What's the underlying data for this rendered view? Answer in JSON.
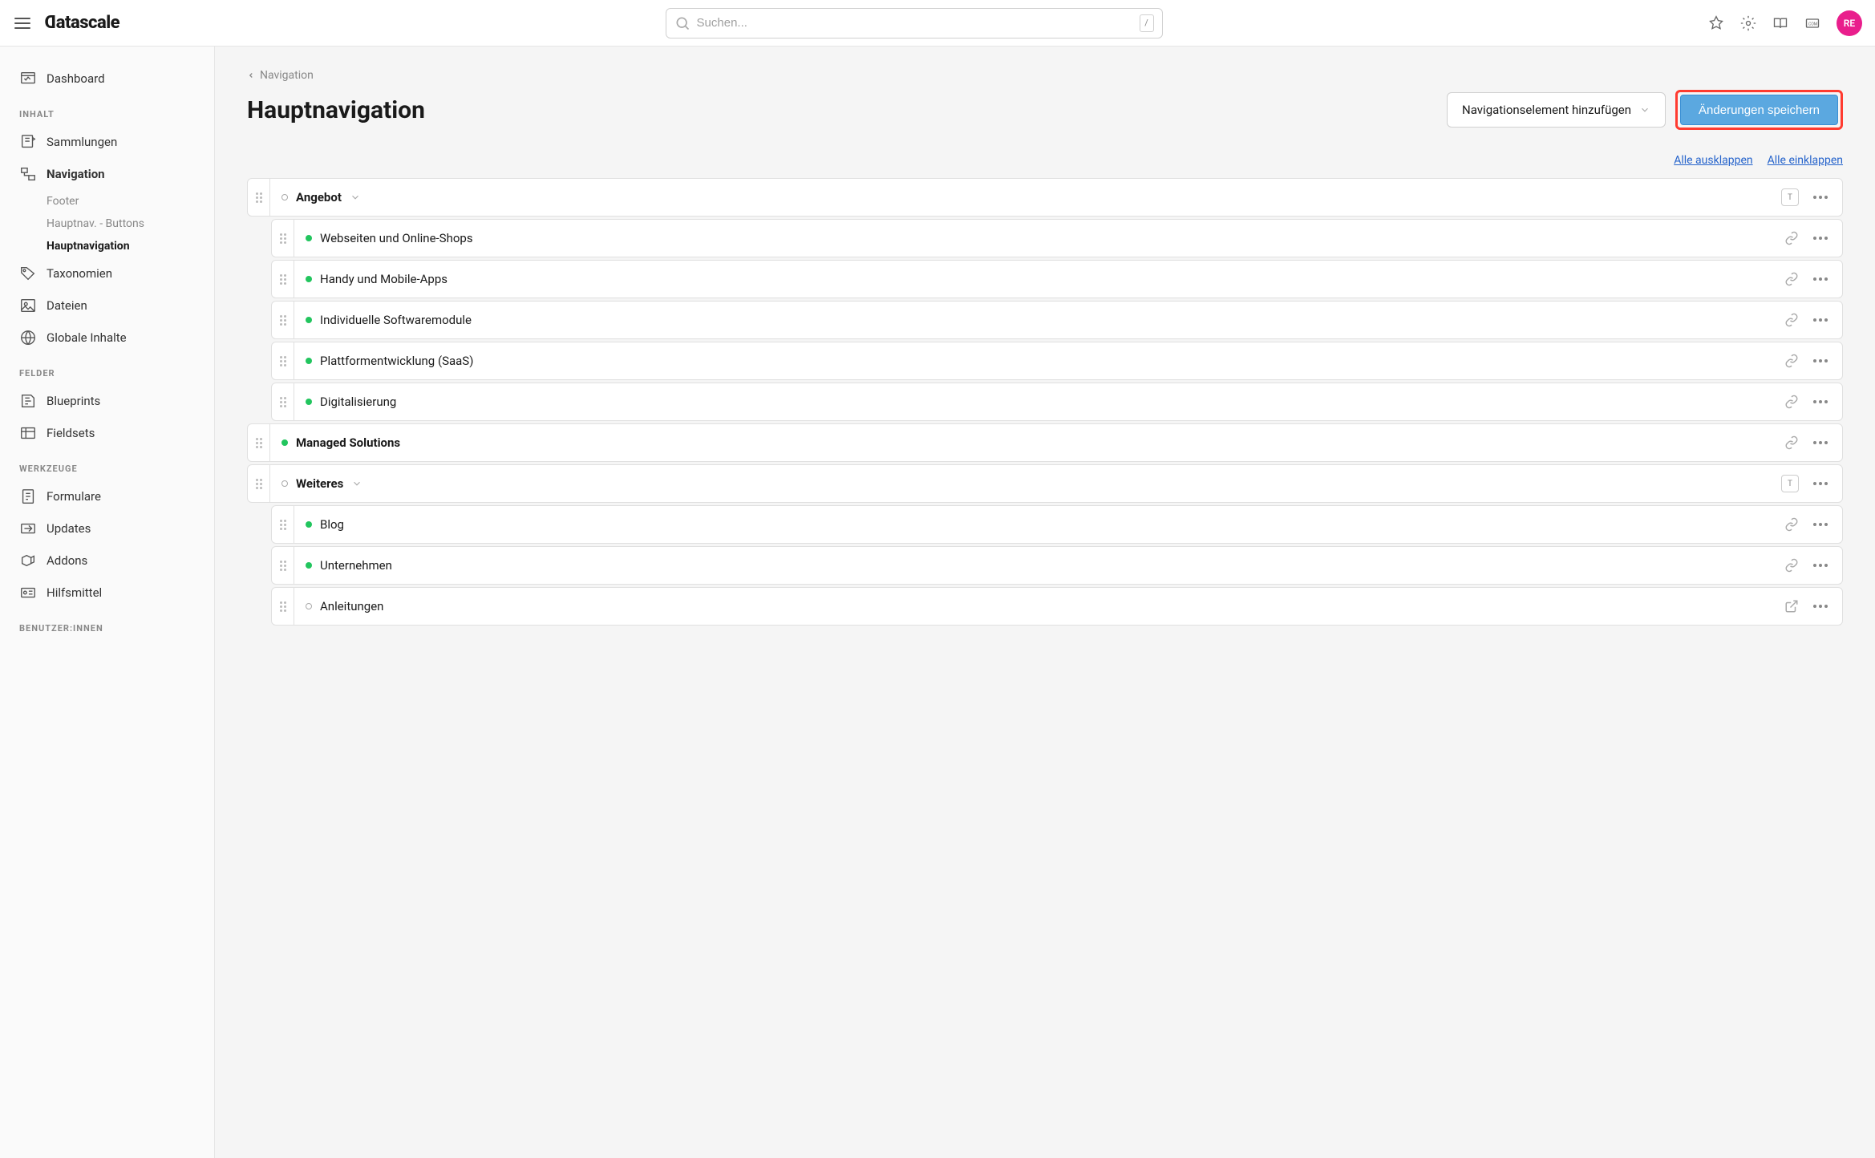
{
  "header": {
    "logo": "Datascale",
    "search_placeholder": "Suchen...",
    "search_kbd": "/",
    "avatar_initials": "RE"
  },
  "sidebar": {
    "dashboard": "Dashboard",
    "sections": {
      "inhalt": "INHALT",
      "felder": "FELDER",
      "werkzeuge": "WERKZEUGE",
      "benutzer": "BENUTZER:INNEN"
    },
    "items": {
      "sammlungen": "Sammlungen",
      "navigation": "Navigation",
      "taxonomien": "Taxonomien",
      "dateien": "Dateien",
      "globale": "Globale Inhalte",
      "blueprints": "Blueprints",
      "fieldsets": "Fieldsets",
      "formulare": "Formulare",
      "updates": "Updates",
      "addons": "Addons",
      "hilfsmittel": "Hilfsmittel"
    },
    "nav_sub": {
      "footer": "Footer",
      "hauptnav_buttons": "Hauptnav. - Buttons",
      "hauptnavigation": "Hauptnavigation"
    }
  },
  "main": {
    "breadcrumb": "Navigation",
    "title": "Hauptnavigation",
    "add_element": "Navigationselement hinzufügen",
    "save": "Änderungen speichern",
    "expand_all": "Alle ausklappen",
    "collapse_all": "Alle einklappen"
  },
  "tree": [
    {
      "label": "Angebot",
      "status": "empty",
      "bold": true,
      "has_children": true,
      "trailing": "text-box"
    },
    {
      "label": "Webseiten und Online-Shops",
      "status": "green",
      "child": true,
      "trailing": "link"
    },
    {
      "label": "Handy und Mobile-Apps",
      "status": "green",
      "child": true,
      "trailing": "link"
    },
    {
      "label": "Individuelle Softwaremodule",
      "status": "green",
      "child": true,
      "trailing": "link"
    },
    {
      "label": "Plattformentwicklung (SaaS)",
      "status": "green",
      "child": true,
      "trailing": "link"
    },
    {
      "label": "Digitalisierung",
      "status": "green",
      "child": true,
      "trailing": "link"
    },
    {
      "label": "Managed Solutions",
      "status": "green",
      "bold": true,
      "trailing": "link"
    },
    {
      "label": "Weiteres",
      "status": "empty",
      "bold": true,
      "has_children": true,
      "trailing": "text-box"
    },
    {
      "label": "Blog",
      "status": "green",
      "child": true,
      "trailing": "link"
    },
    {
      "label": "Unternehmen",
      "status": "green",
      "child": true,
      "trailing": "link"
    },
    {
      "label": "Anleitungen",
      "status": "empty",
      "child": true,
      "trailing": "external"
    }
  ]
}
